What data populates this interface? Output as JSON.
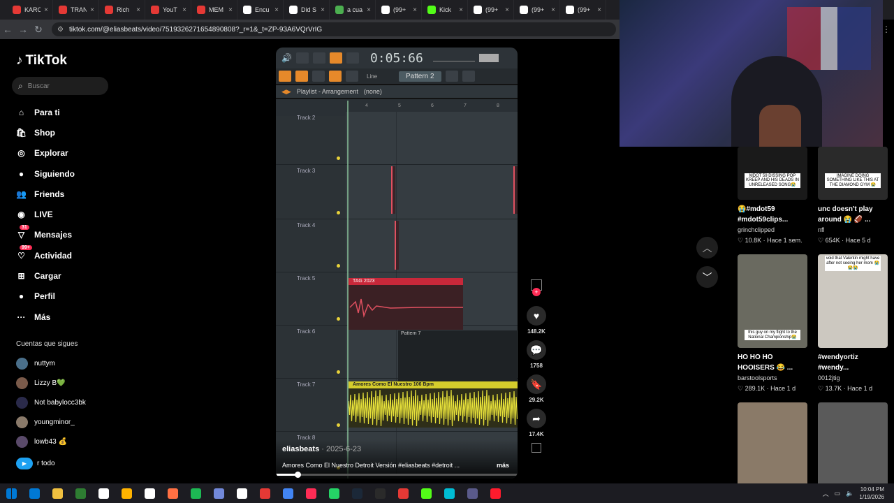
{
  "tabs": [
    {
      "label": "KARO",
      "color": "#e53935"
    },
    {
      "label": "TRAN",
      "color": "#e53935"
    },
    {
      "label": "Rich",
      "color": "#e53935"
    },
    {
      "label": "YouT",
      "color": "#e53935"
    },
    {
      "label": "MEM",
      "color": "#e53935"
    },
    {
      "label": "Encu",
      "color": "#ffffff"
    },
    {
      "label": "Did S",
      "color": "#ffffff"
    },
    {
      "label": "a cua",
      "color": "#4caf50"
    },
    {
      "label": "(99+",
      "color": "#ffffff"
    },
    {
      "label": "Kick",
      "color": "#53fc18"
    },
    {
      "label": "(99+",
      "color": "#ffffff"
    },
    {
      "label": "(99+",
      "color": "#ffffff"
    },
    {
      "label": "(99+",
      "color": "#ffffff"
    }
  ],
  "browser": {
    "url": "tiktok.com/@eliasbeats/video/7519326271654890808?_r=1&_t=ZP-93A6VQrVrIG"
  },
  "sidebar": {
    "logo": "TikTok",
    "search_placeholder": "Buscar",
    "items": [
      {
        "label": "Para ti",
        "icon": "home-icon",
        "glyph": "⌂"
      },
      {
        "label": "Shop",
        "icon": "shop-icon",
        "glyph": "🛍"
      },
      {
        "label": "Explorar",
        "icon": "compass-icon",
        "glyph": "◎"
      },
      {
        "label": "Siguiendo",
        "icon": "avatar-icon",
        "glyph": "●"
      },
      {
        "label": "Friends",
        "icon": "friends-icon",
        "glyph": "👥"
      },
      {
        "label": "LIVE",
        "icon": "live-icon",
        "glyph": "◉"
      },
      {
        "label": "Mensajes",
        "icon": "inbox-icon",
        "glyph": "▽",
        "badge": "31"
      },
      {
        "label": "Actividad",
        "icon": "activity-icon",
        "glyph": "♡",
        "badge": "99+"
      },
      {
        "label": "Cargar",
        "icon": "upload-icon",
        "glyph": "⊞"
      },
      {
        "label": "Perfil",
        "icon": "profile-icon",
        "glyph": "●"
      },
      {
        "label": "Más",
        "icon": "more-icon",
        "glyph": "···"
      }
    ],
    "following_header": "Cuentas que sigues",
    "following": [
      {
        "name": "nuttym",
        "color": "#4a6f8a"
      },
      {
        "name": "Lizzy B💚",
        "color": "#7a5a4a"
      },
      {
        "name": "Not babylocc3bk",
        "color": "#2a2a4a"
      },
      {
        "name": "youngminor_",
        "color": "#8a7a6a"
      },
      {
        "name": "lowb43 💰",
        "color": "#5a4a6a"
      }
    ],
    "see_all": "r todo"
  },
  "video": {
    "timer": "0:05:66",
    "tool_label": "Line",
    "pattern": "Pattern 2",
    "playlist_label": "Playlist - Arrangement",
    "playlist_sub": "(none)",
    "ruler_marks": [
      "4",
      "5",
      "6",
      "7",
      "8"
    ],
    "tracks": [
      {
        "label": "Track 2"
      },
      {
        "label": "Track 3"
      },
      {
        "label": "Track 4"
      },
      {
        "label": "Track 5"
      },
      {
        "label": "Track 6"
      },
      {
        "label": "Track 7"
      },
      {
        "label": "Track 8"
      }
    ],
    "clip_tag": "TAG 2023",
    "clip_pattern": "Pattern 7",
    "clip_audio": "Amores Como El Nuestro 106 Bpm",
    "author": "eliasbeats",
    "date": " · 2025-6-23",
    "description": "Amores Como El Nuestro Detroit Versión #eliasbeats #detroit ...",
    "more": "más",
    "progress": 0.09
  },
  "actions": {
    "likes": "148.2K",
    "comments": "1758",
    "saves": "29.2K",
    "shares": "17.4K"
  },
  "feed": [
    {
      "title": "😭#mdot59 #mdot59clips...",
      "author": "grinchclipped",
      "stats": "♡ 10.8K · Hace 1 sem.",
      "thumb_text": "MDOT 59 DISSING POP KREEP AND HIS DEADS IN UNRELEASED SONG😭",
      "bg": "#1a1a1a"
    },
    {
      "title": "unc doesn't play around 😭 🏈 ...",
      "author": "nfl",
      "stats": "♡ 654K · Hace 5 d",
      "thumb_text": "IMAGINE DOING SOMETHING LIKE THIS AT THE DIAMOND GYM 😭",
      "bg": "#2a2a2a"
    },
    {
      "title": "HO HO HO HOOISERS 😂 ...",
      "author": "barstoolsports",
      "stats": "♡ 289.1K · Hace 1 d",
      "thumb_text": "this guy on my flight to the National Championship😭",
      "bg": "#6a6a60"
    },
    {
      "title": "#wendyortiz #wendy...",
      "author": "0012jtig",
      "stats": "♡ 13.7K · Hace 1 d",
      "thumb_text": "void that Valentin might have after not seeing her mom 😭😭😭",
      "bg": "#ccc8c0"
    },
    {
      "title": "",
      "author": "",
      "stats": "",
      "thumb_text": "",
      "bg": "#8a7a68"
    },
    {
      "title": "",
      "author": "",
      "stats": "",
      "thumb_text": "",
      "bg": "#5a5a5a"
    }
  ],
  "taskbar": {
    "time": "10:04 PM",
    "date": "1/19/2026",
    "icons": [
      "#0078d4",
      "#f0c040",
      "#2e7d32",
      "#ffffff",
      "#ffb300",
      "#ffffff",
      "#ff7043",
      "#1db954",
      "#7289da",
      "#ffffff",
      "#e53935",
      "#4285f4",
      "#fe2c55",
      "#25d366",
      "#1b2838",
      "#2a2a2a",
      "#e53935",
      "#53fc18",
      "#00bcd4",
      "#5a5a8a",
      "#ff1b2d"
    ]
  }
}
